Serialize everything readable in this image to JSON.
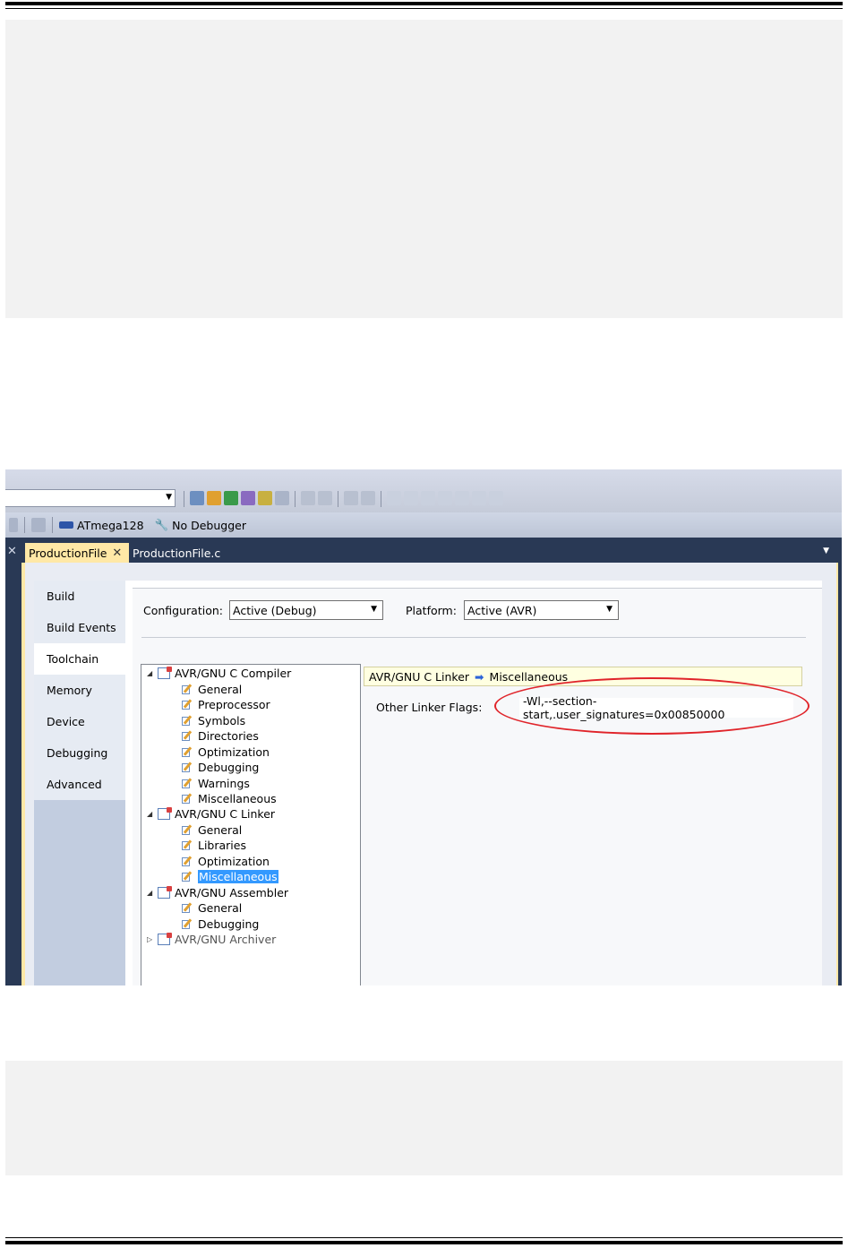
{
  "toolbar": {
    "device": "ATmega128",
    "debugger": "No Debugger"
  },
  "tabs": [
    {
      "label": "ProductionFile",
      "close": "✕"
    },
    {
      "label": "ProductionFile.c"
    }
  ],
  "nav": [
    "Build",
    "Build Events",
    "Toolchain",
    "Memory",
    "Device",
    "Debugging",
    "Advanced"
  ],
  "config": {
    "configuration_label": "Configuration:",
    "configuration_value": "Active (Debug)",
    "platform_label": "Platform:",
    "platform_value": "Active (AVR)"
  },
  "tree": {
    "compiler": "AVR/GNU C Compiler",
    "compiler_children": [
      "General",
      "Preprocessor",
      "Symbols",
      "Directories",
      "Optimization",
      "Debugging",
      "Warnings",
      "Miscellaneous"
    ],
    "linker": "AVR/GNU C Linker",
    "linker_children": [
      "General",
      "Libraries",
      "Optimization",
      "Miscellaneous"
    ],
    "assembler": "AVR/GNU Assembler",
    "assembler_children": [
      "General",
      "Debugging"
    ],
    "archiver": "AVR/GNU Archiver"
  },
  "detail": {
    "crumb_parent": "AVR/GNU C Linker",
    "crumb_child": "Miscellaneous",
    "flags_label": "Other Linker Flags:",
    "flags_value": "-Wl,--section-start,.user_signatures=0x00850000"
  },
  "colors": {
    "highlight_ellipse": "#e0242a",
    "active_tab": "#ffe8a6",
    "selection": "#3399ff"
  }
}
